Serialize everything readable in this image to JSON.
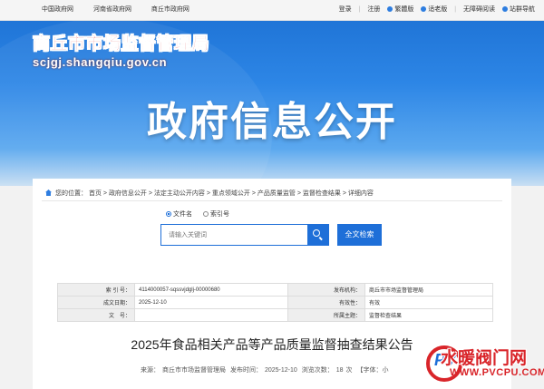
{
  "topbar": {
    "links": [
      "中国政府网",
      "河南省政府网",
      "商丘市政府网"
    ],
    "login": "登录",
    "sep": "|",
    "register": "注册",
    "traditional": "繁體版",
    "elderly": "适老版",
    "accessible": "无障碍阅读",
    "sitemap": "站群导航"
  },
  "site": {
    "name_cn": "商丘市市场监督管理局",
    "domain": "scjgj.shangqiu.gov.cn"
  },
  "hero_title": "政府信息公开",
  "breadcrumb": {
    "prefix": "您的位置：",
    "items": [
      "首页",
      "政府信息公开",
      "法定主动公开内容",
      "重点领域公开",
      "产品质量监管",
      "监督检查结果",
      "详细内容"
    ],
    "separator": " > "
  },
  "search": {
    "options": [
      "文件名",
      "索引号"
    ],
    "selected": "文件名",
    "placeholder": "请输入关键词",
    "full_search_label": "全文检索"
  },
  "meta": {
    "rows": [
      {
        "k1": "索 引 号：",
        "v1": "4114000057-sqssvjdglj-00000680",
        "k2": "发布机构：",
        "v2": "商丘市市场监督管理局"
      },
      {
        "k1": "成文日期：",
        "v1": "2025-12-10",
        "k2": "有效性：",
        "v2": "有效"
      },
      {
        "k1": "文　号：",
        "v1": "",
        "k2": "所属主题：",
        "v2": "监督检查结果"
      }
    ]
  },
  "article": {
    "title": "2025年食品相关产品等产品质量监督抽查结果公告",
    "source_label": "来源：",
    "source": "商丘市市场监督管理局",
    "time_label": "发布时间：",
    "time": "2025-12-10",
    "views_label": "浏览次数：",
    "views": "18",
    "views_unit": "次",
    "font_label": "【字体：小"
  },
  "watermark": {
    "text_cn": "水暖阀门网",
    "text_en": "WWW.PVCPU.COM",
    "logo_letters": "PV"
  },
  "colors": {
    "primary": "#1e6fd8",
    "logo_red": "#d9252a"
  }
}
